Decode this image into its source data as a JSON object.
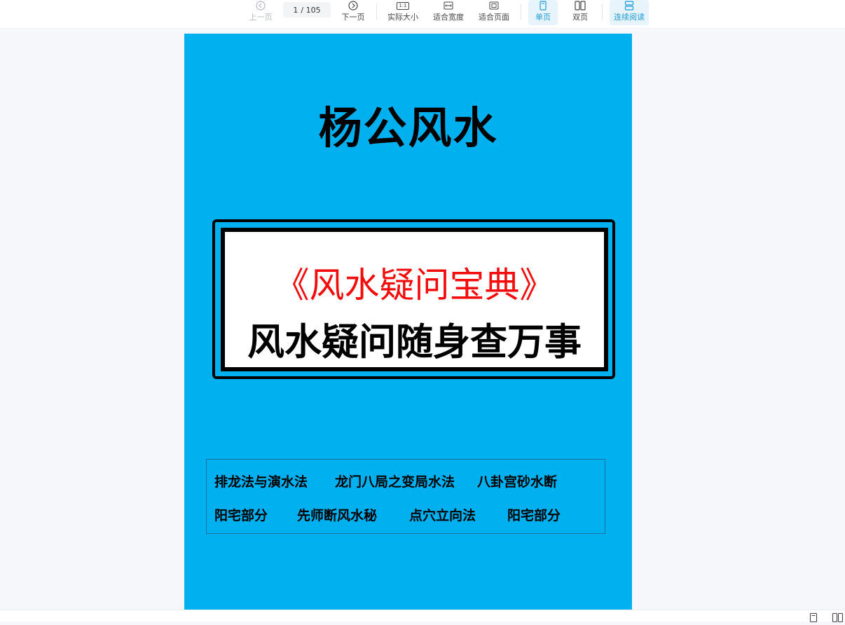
{
  "toolbar": {
    "prev_label": "上一页",
    "next_label": "下一页",
    "page_current": "1",
    "page_total": "/ 105",
    "actual_size_label": "实际大小",
    "actual_size_glyph": "1:1",
    "fit_width_label": "适合宽度",
    "fit_page_label": "适合页面",
    "single_page_label": "单页",
    "double_page_label": "双页",
    "continuous_label": "连续阅读",
    "active_color": "#1d9bd8"
  },
  "document": {
    "page_bg": "#00b0ef",
    "title": "杨公风水",
    "subtitle_red": "《风水疑问宝典》",
    "subtitle_black": "风水疑问随身查万事",
    "topics_row1": [
      "排龙法与演水法",
      "龙门八局之变局水法",
      "八卦宫砂水断"
    ],
    "topics_row2": [
      "阳宅部分",
      "先师断风水秘",
      "点穴立向法",
      "阳宅部分"
    ]
  },
  "icons": {
    "prev": "chevron-left-circle-icon",
    "next": "chevron-right-circle-icon",
    "single": "single-page-icon",
    "double": "double-page-icon",
    "continuous": "continuous-scroll-icon"
  }
}
